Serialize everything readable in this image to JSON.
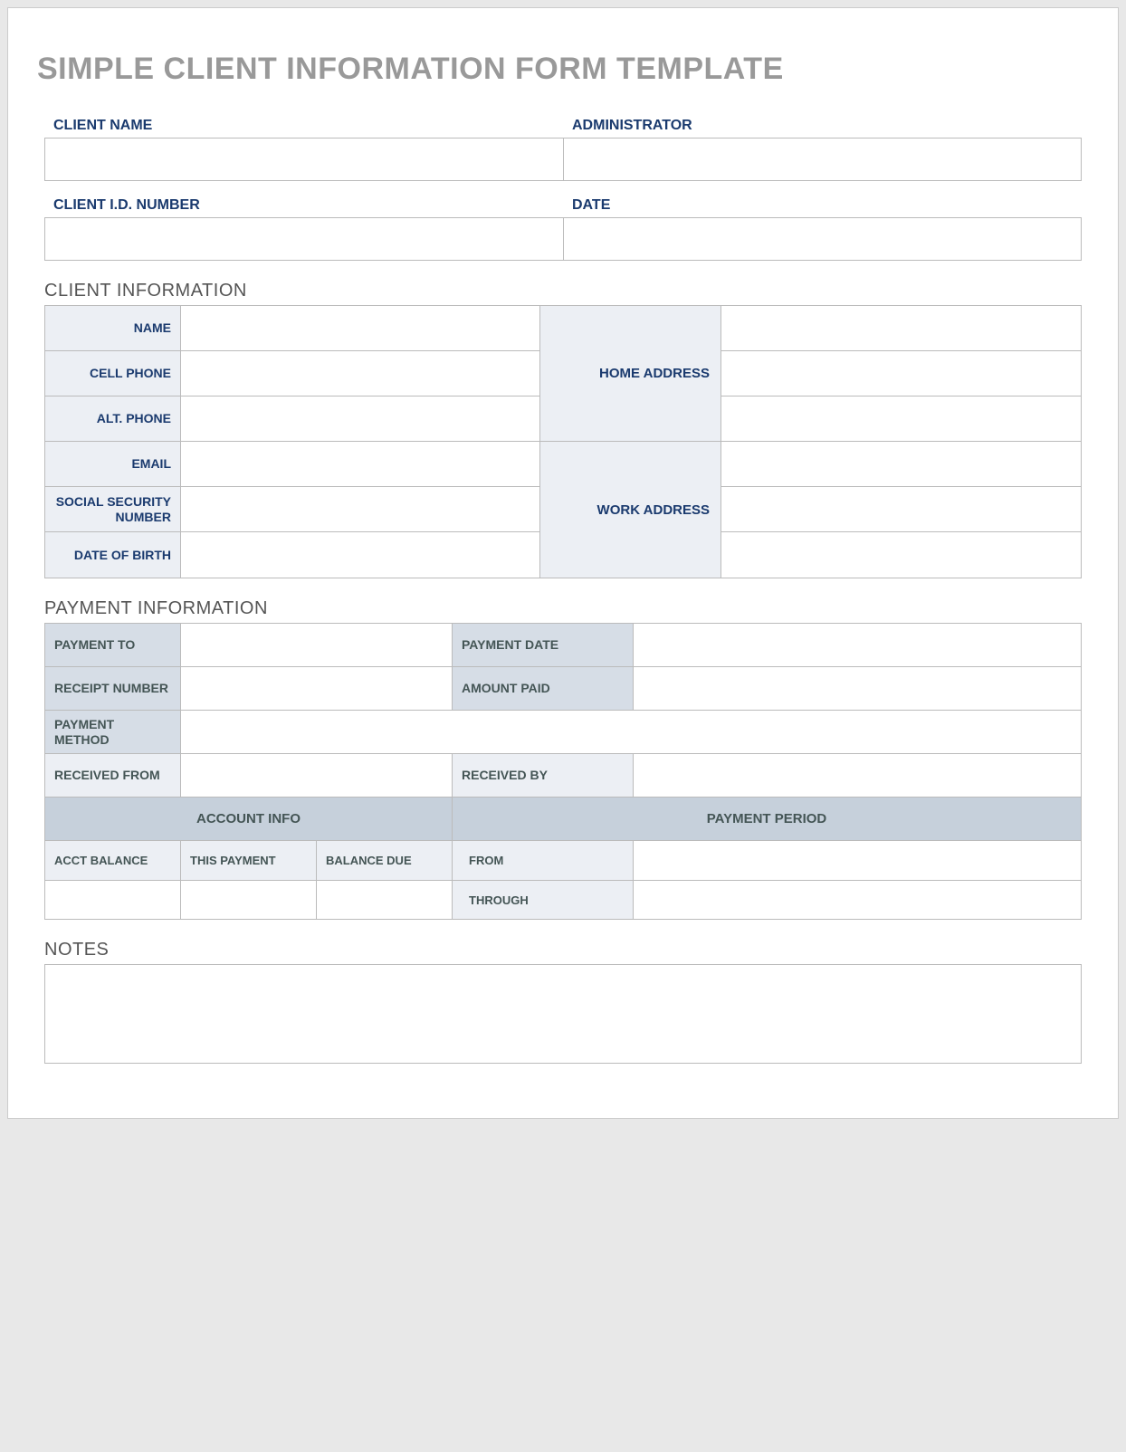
{
  "title": "SIMPLE CLIENT INFORMATION FORM TEMPLATE",
  "header": {
    "client_name_label": "CLIENT NAME",
    "administrator_label": "ADMINISTRATOR",
    "client_id_label": "CLIENT I.D. NUMBER",
    "date_label": "DATE"
  },
  "client_info": {
    "section_title": "CLIENT INFORMATION",
    "name_label": "NAME",
    "cell_phone_label": "CELL PHONE",
    "alt_phone_label": "ALT. PHONE",
    "email_label": "EMAIL",
    "ssn_label": "SOCIAL SECURITY NUMBER",
    "dob_label": "DATE OF BIRTH",
    "home_address_label": "HOME ADDRESS",
    "work_address_label": "WORK ADDRESS"
  },
  "payment_info": {
    "section_title": "PAYMENT INFORMATION",
    "payment_to_label": "PAYMENT TO",
    "payment_date_label": "PAYMENT DATE",
    "receipt_number_label": "RECEIPT NUMBER",
    "amount_paid_label": "AMOUNT PAID",
    "payment_method_label": "PAYMENT METHOD",
    "received_from_label": "RECEIVED FROM",
    "received_by_label": "RECEIVED BY",
    "account_info_header": "ACCOUNT INFO",
    "payment_period_header": "PAYMENT PERIOD",
    "acct_balance_label": "ACCT BALANCE",
    "this_payment_label": "THIS PAYMENT",
    "balance_due_label": "BALANCE DUE",
    "from_label": "FROM",
    "through_label": "THROUGH"
  },
  "notes": {
    "section_title": "NOTES"
  }
}
